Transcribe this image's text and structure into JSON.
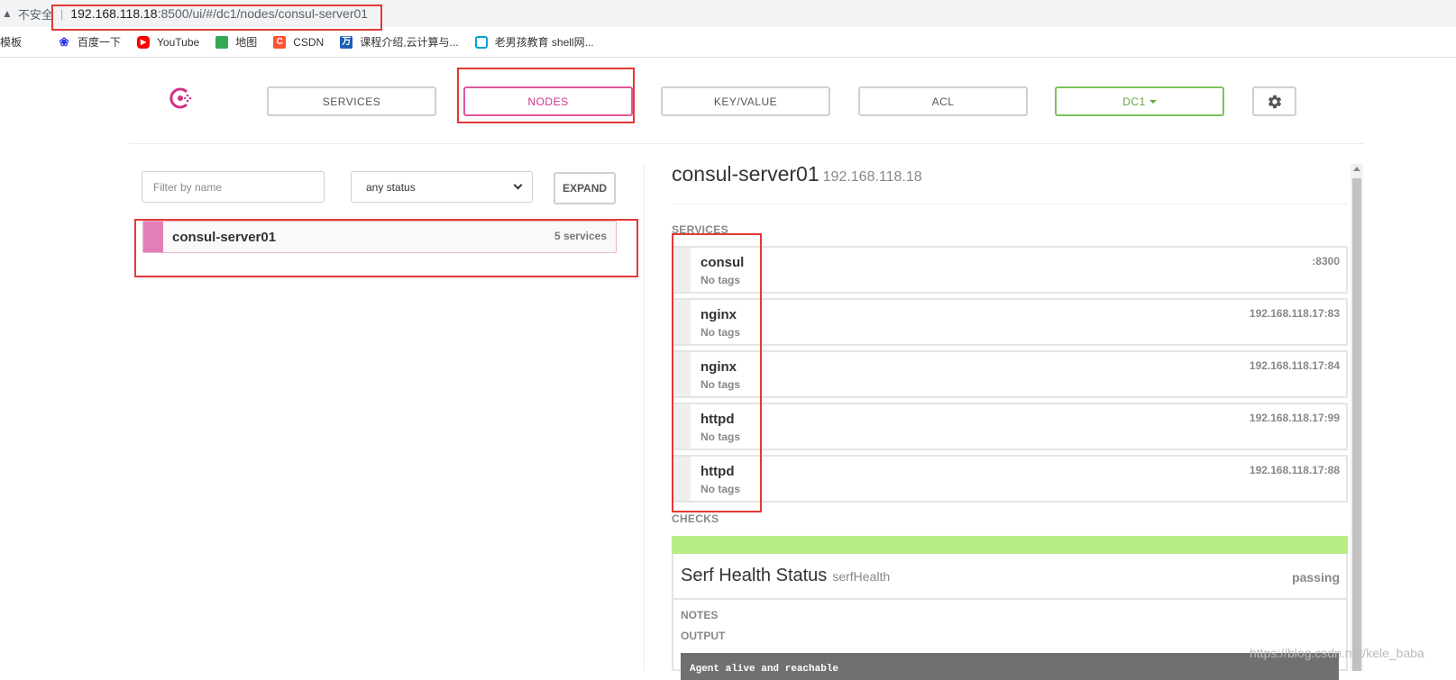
{
  "browser": {
    "warn_icon": "warning-triangle-icon",
    "insecure_label": "不安全",
    "url_host": "192.168.118.18",
    "url_path": ":8500/ui/#/dc1/nodes/consul-server01"
  },
  "bookmarks": [
    {
      "label": "模板",
      "icon": "none"
    },
    {
      "label": "百度一下",
      "icon": "baidu-paw-icon",
      "color": "#2932e1"
    },
    {
      "label": "YouTube",
      "icon": "youtube-icon",
      "color": "#ff0000"
    },
    {
      "label": "地图",
      "icon": "maps-icon",
      "color": "#34a853"
    },
    {
      "label": "CSDN",
      "icon": "csdn-icon",
      "color": "#fc5531"
    },
    {
      "label": "课程介绍,云计算与...",
      "icon": "wanfang-icon",
      "color": "#1a5fb4"
    },
    {
      "label": "老男孩教育 shell网...",
      "icon": "bilibili-tv-icon",
      "color": "#00a1d6"
    }
  ],
  "nav": {
    "services": "SERVICES",
    "nodes": "NODES",
    "keyvalue": "KEY/VALUE",
    "acl": "ACL",
    "dc": "DC1",
    "logo_color": "#d0318b",
    "active_color": "#e0579c",
    "dc_color": "#7cc35b"
  },
  "filter": {
    "placeholder": "Filter by name",
    "status_selected": "any status",
    "expand_label": "EXPAND"
  },
  "nodes": [
    {
      "name": "consul-server01",
      "services": "5 services"
    }
  ],
  "detail": {
    "name": "consul-server01",
    "ip": "192.168.118.18",
    "services_heading": "SERVICES",
    "services": [
      {
        "name": "consul",
        "tags": "No tags",
        "address": ":8300"
      },
      {
        "name": "nginx",
        "tags": "No tags",
        "address": "192.168.118.17:83"
      },
      {
        "name": "nginx",
        "tags": "No tags",
        "address": "192.168.118.17:84"
      },
      {
        "name": "httpd",
        "tags": "No tags",
        "address": "192.168.118.17:99"
      },
      {
        "name": "httpd",
        "tags": "No tags",
        "address": "192.168.118.17:88"
      }
    ],
    "checks_heading": "CHECKS",
    "check": {
      "name": "Serf Health Status",
      "id": "serfHealth",
      "status": "passing",
      "status_color": "#b8ec84",
      "notes_label": "NOTES",
      "output_label": "OUTPUT",
      "output": "Agent alive and reachable"
    }
  },
  "watermark": "https://blog.csdn.net/kele_baba"
}
